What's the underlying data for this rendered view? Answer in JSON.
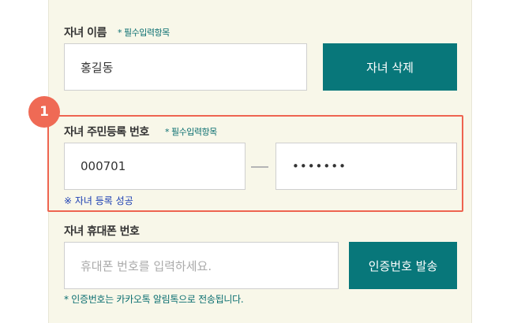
{
  "child_name": {
    "label": "자녀 이름",
    "required": "* 필수입력항목",
    "value": "홍길동",
    "delete_button": "자녀 삭제"
  },
  "rrn": {
    "badge": "1",
    "label": "자녀 주민등록 번호",
    "required": "* 필수입력항목",
    "front_value": "000701",
    "back_value": "•••••••",
    "status": "※ 자녀 등록 성공"
  },
  "phone": {
    "label": "자녀 휴대폰 번호",
    "placeholder": "휴대폰 번호를 입력하세요.",
    "send_button": "인증번호 발송",
    "note": "* 인증번호는 카카오톡 알림톡으로 전송됩니다."
  },
  "colors": {
    "accent": "#08777a",
    "highlight": "#ee6450",
    "panel_bg": "#f8f7e9",
    "success_text": "#1c3fb3"
  }
}
